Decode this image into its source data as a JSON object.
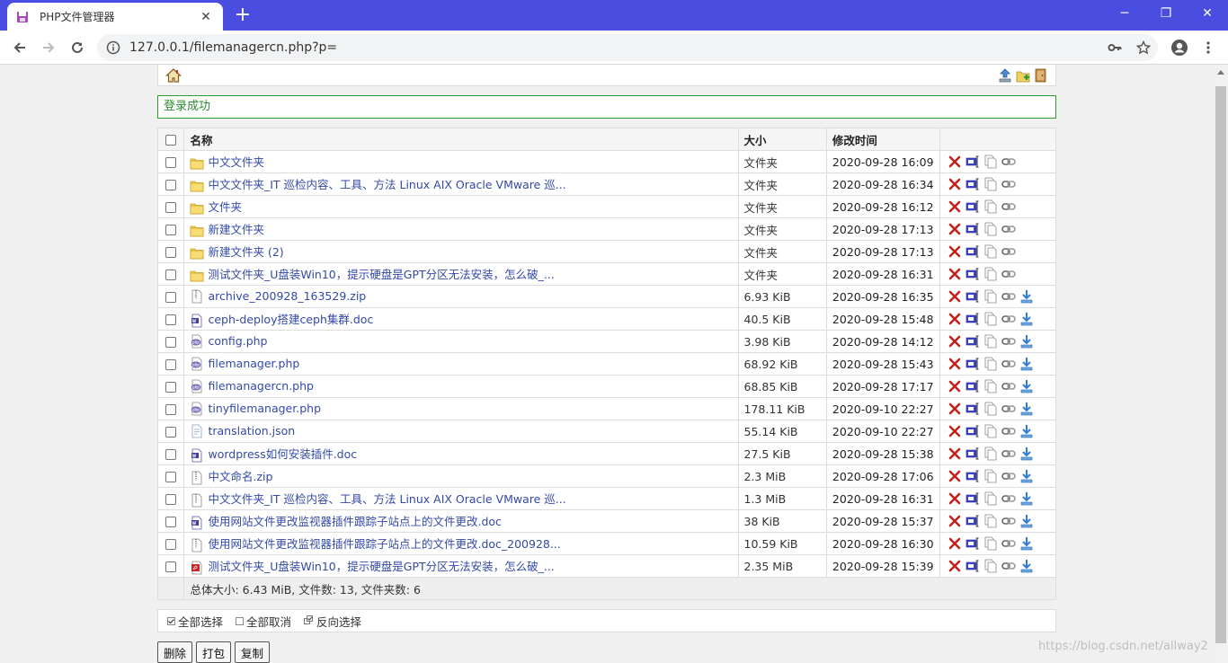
{
  "browser": {
    "tab_title": "PHP文件管理器",
    "url": "127.0.0.1/filemanagercn.php?p="
  },
  "alert": "登录成功",
  "table": {
    "headers": {
      "name": "名称",
      "size": "大小",
      "modified": "修改时间"
    },
    "rows": [
      {
        "type": "folder",
        "name": "中文文件夹",
        "size": "文件夹",
        "time": "2020-09-28 16:09",
        "download": false
      },
      {
        "type": "folder",
        "name": "中文文件夹_IT 巡检内容、工具、方法 Linux AIX Oracle VMware 巡...",
        "size": "文件夹",
        "time": "2020-09-28 16:34",
        "download": false
      },
      {
        "type": "folder",
        "name": "文件夹",
        "size": "文件夹",
        "time": "2020-09-28 16:12",
        "download": false
      },
      {
        "type": "folder",
        "name": "新建文件夹",
        "size": "文件夹",
        "time": "2020-09-28 17:13",
        "download": false
      },
      {
        "type": "folder",
        "name": "新建文件夹 (2)",
        "size": "文件夹",
        "time": "2020-09-28 17:13",
        "download": false
      },
      {
        "type": "folder",
        "name": "测试文件夹_U盘装Win10，提示硬盘是GPT分区无法安装，怎么破_...",
        "size": "文件夹",
        "time": "2020-09-28 16:31",
        "download": false
      },
      {
        "type": "zip",
        "name": "archive_200928_163529.zip",
        "size": "6.93 KiB",
        "time": "2020-09-28 16:35",
        "download": true
      },
      {
        "type": "doc",
        "name": "ceph-deploy搭建ceph集群.doc",
        "size": "40.5 KiB",
        "time": "2020-09-28 15:48",
        "download": true
      },
      {
        "type": "php",
        "name": "config.php",
        "size": "3.98 KiB",
        "time": "2020-09-28 14:12",
        "download": true
      },
      {
        "type": "php",
        "name": "filemanager.php",
        "size": "68.92 KiB",
        "time": "2020-09-28 15:43",
        "download": true
      },
      {
        "type": "php",
        "name": "filemanagercn.php",
        "size": "68.85 KiB",
        "time": "2020-09-28 17:17",
        "download": true
      },
      {
        "type": "php",
        "name": "tinyfilemanager.php",
        "size": "178.11 KiB",
        "time": "2020-09-10 22:27",
        "download": true
      },
      {
        "type": "json",
        "name": "translation.json",
        "size": "55.14 KiB",
        "time": "2020-09-10 22:27",
        "download": true
      },
      {
        "type": "doc",
        "name": "wordpress如何安装插件.doc",
        "size": "27.5 KiB",
        "time": "2020-09-28 15:38",
        "download": true
      },
      {
        "type": "zip",
        "name": "中文命名.zip",
        "size": "2.3 MiB",
        "time": "2020-09-28 17:06",
        "download": true
      },
      {
        "type": "zip",
        "name": "中文文件夹_IT 巡检内容、工具、方法 Linux AIX Oracle VMware 巡...",
        "size": "1.3 MiB",
        "time": "2020-09-28 16:31",
        "download": true
      },
      {
        "type": "doc",
        "name": "使用网站文件更改监视器插件跟踪子站点上的文件更改.doc",
        "size": "38 KiB",
        "time": "2020-09-28 15:37",
        "download": true
      },
      {
        "type": "zip",
        "name": "使用网站文件更改监视器插件跟踪子站点上的文件更改.doc_200928...",
        "size": "10.59 KiB",
        "time": "2020-09-28 16:30",
        "download": true
      },
      {
        "type": "pdf",
        "name": "测试文件夹_U盘装Win10，提示硬盘是GPT分区无法安装，怎么破_...",
        "size": "2.35 MiB",
        "time": "2020-09-28 15:39",
        "download": true
      }
    ],
    "summary": "总体大小: 6.43 MiB, 文件数: 13, 文件夹数: 6"
  },
  "select_actions": {
    "select_all": "全部选择",
    "unselect_all": "全部取消",
    "invert": "反向选择"
  },
  "buttons": {
    "delete": "删除",
    "pack": "打包",
    "copy": "复制"
  },
  "watermark": "https://blog.csdn.net/allway2"
}
